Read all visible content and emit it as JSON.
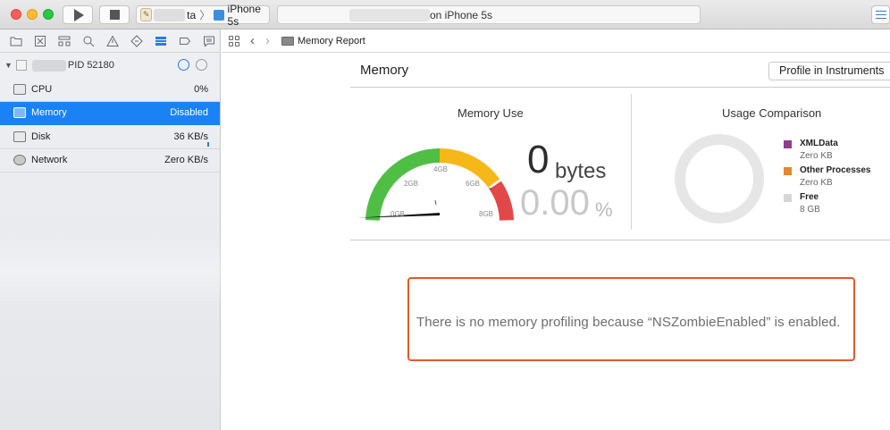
{
  "titlebar": {
    "scheme_target_suffix": "ta",
    "scheme_device": "iPhone 5s",
    "activity_text": "on iPhone 5s",
    "icons": [
      "play-icon",
      "stop-icon",
      "editor-layout-icon"
    ]
  },
  "navigator": {
    "tabs": [
      "folder-icon",
      "source-control-icon",
      "hierarchy-icon",
      "search-icon",
      "warning-icon",
      "test-icon",
      "debug-icon",
      "breakpoint-icon",
      "report-icon"
    ],
    "process_label": "PID 52180",
    "items": [
      {
        "label": "CPU",
        "value": "0%"
      },
      {
        "label": "Memory",
        "value": "Disabled"
      },
      {
        "label": "Disk",
        "value": "36 KB/s"
      },
      {
        "label": "Network",
        "value": "Zero KB/s"
      }
    ]
  },
  "jumpbar": {
    "title": "Memory Report"
  },
  "report": {
    "title": "Memory",
    "profile_button": "Profile in Instruments",
    "memory_use": {
      "title": "Memory Use",
      "value": "0",
      "unit": "bytes",
      "percent": "0.00",
      "percent_sign": "%",
      "gauge_labels": [
        "0GB",
        "2GB",
        "4GB",
        "6GB",
        "8GB"
      ],
      "gauge_level": 0,
      "colors": {
        "green": "#4fbe45",
        "yellow": "#f6b719",
        "red": "#e34848"
      }
    },
    "usage_comparison": {
      "title": "Usage Comparison",
      "legend": [
        {
          "name": "XMLData",
          "value": "Zero KB",
          "color": "#8e3d8f"
        },
        {
          "name": "Other Processes",
          "value": "Zero KB",
          "color": "#e8862a"
        },
        {
          "name": "Free",
          "value": "8 GB",
          "color": "#d6d6d6"
        }
      ]
    },
    "notice": "There is no memory profiling because “NSZombieEnabled” is enabled.",
    "notice_border_color": "#e05a2b"
  }
}
